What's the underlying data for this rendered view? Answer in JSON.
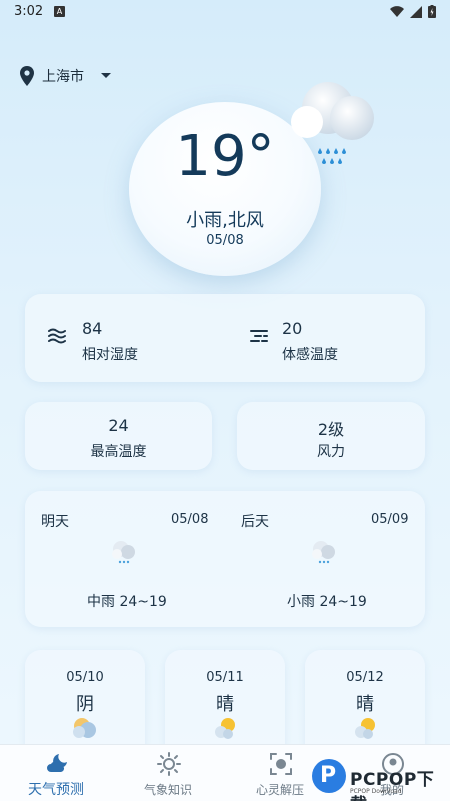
{
  "status": {
    "time": "3:02",
    "a_icon": "A"
  },
  "location": {
    "city": "上海市"
  },
  "current": {
    "temp": "19°",
    "condition": "小雨,北风",
    "date": "05/08"
  },
  "metrics": {
    "humidity": {
      "value": "84",
      "label": "相对湿度"
    },
    "feels_like": {
      "value": "20",
      "label": "体感温度"
    },
    "max_temp": {
      "value": "24",
      "label": "最高温度"
    },
    "wind": {
      "value": "2级",
      "label": "风力"
    }
  },
  "forecast": [
    {
      "day": "明天",
      "date": "05/08",
      "summary": "中雨 24~19",
      "icon": "cloud-rain-icon"
    },
    {
      "day": "后天",
      "date": "05/09",
      "summary": "小雨 24~19",
      "icon": "cloud-rain-icon"
    }
  ],
  "later": [
    {
      "date": "05/10",
      "weather": "阴",
      "icon": "overcast-icon"
    },
    {
      "date": "05/11",
      "weather": "晴",
      "icon": "sun-cloud-icon"
    },
    {
      "date": "05/12",
      "weather": "晴",
      "icon": "sun-cloud-icon"
    }
  ],
  "tabs": [
    {
      "label": "天气预测",
      "active": true,
      "icon": "cloud-moon-icon"
    },
    {
      "label": "气象知识",
      "active": false,
      "icon": "sun-icon"
    },
    {
      "label": "心灵解压",
      "active": false,
      "icon": "focus-icon"
    },
    {
      "label": "我的",
      "active": false,
      "icon": "user-icon"
    }
  ],
  "watermark": {
    "logo": "P",
    "text": "PCPOP下载",
    "sub": "PCPOP Download"
  },
  "colors": {
    "accent": "#2e6fae",
    "text": "#1d3346",
    "background": "#d5ecfa"
  }
}
